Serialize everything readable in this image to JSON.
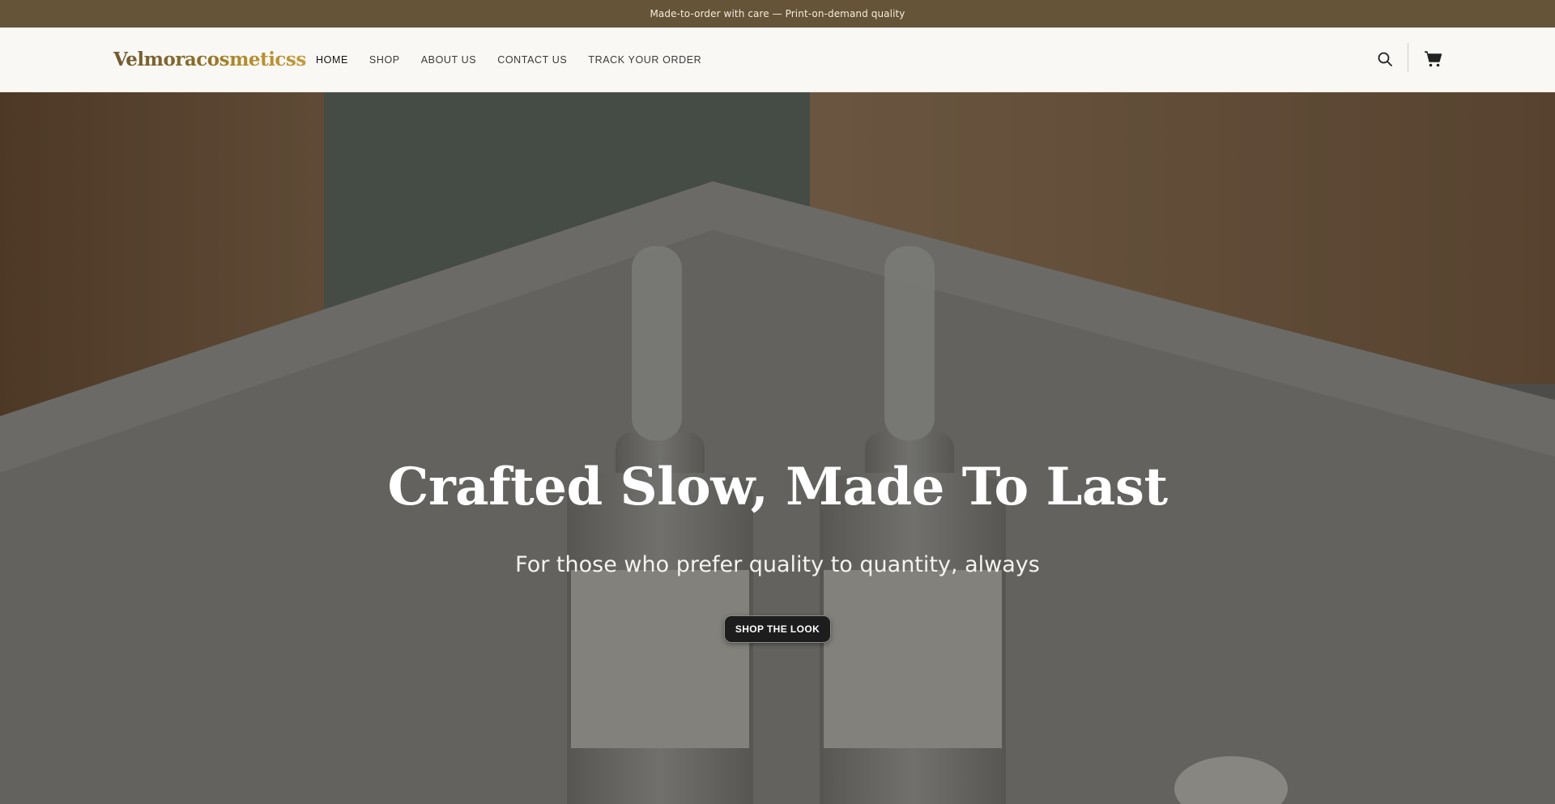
{
  "announcement": {
    "text": "Made-to-order with care — Print-on-demand quality"
  },
  "header": {
    "logo": "Velmoracosmeticss",
    "nav": [
      {
        "label": "HOME",
        "active": true
      },
      {
        "label": "SHOP"
      },
      {
        "label": "ABOUT US"
      },
      {
        "label": "CONTACT US"
      },
      {
        "label": "TRACK YOUR ORDER"
      }
    ],
    "icons": [
      "search-icon",
      "cart-icon"
    ]
  },
  "hero": {
    "title": "Crafted Slow, Made To Last",
    "subtitle": "For those who prefer quality to quantity, always",
    "cta_label": "SHOP THE LOOK"
  },
  "colors": {
    "announcement_bg": "#665438",
    "header_bg": "#f9f8f4",
    "logo_gold": "#b08a2e",
    "button_bg": "#1d1d1d"
  }
}
